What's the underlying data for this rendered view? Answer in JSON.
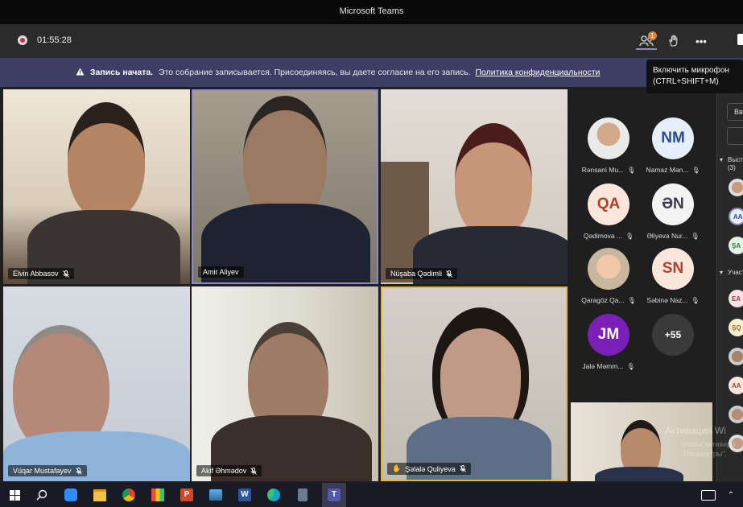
{
  "window": {
    "title": "Microsoft Teams"
  },
  "toolbar": {
    "recording_timer": "01:55:28",
    "participants_badge": "1",
    "more_label": "•••"
  },
  "banner": {
    "bold": "Запись начата.",
    "text": "Это собрание записывается. Присоединяясь, вы даете согласие на его запись.",
    "link": "Политика конфиденциальности"
  },
  "tooltip": {
    "line1": "Включить микрофон",
    "line2": "(CTRL+SHIFT+M)"
  },
  "video_tiles": [
    {
      "name": "Elvin Abbasov"
    },
    {
      "name": "Amir Aliyev"
    },
    {
      "name": "Nüşaba Qədimli"
    },
    {
      "name": "Vüqar Mustafayev"
    },
    {
      "name": "Akif Əhmədov"
    },
    {
      "name": "Şəlalə Quliyeva",
      "raised_hand": "✋"
    }
  ],
  "roster": [
    {
      "initials": "",
      "name": "Rənsani Mu...",
      "photo": true
    },
    {
      "initials": "NM",
      "name": "Namaz Man..."
    },
    {
      "initials": "QA",
      "name": "Qədimova ..."
    },
    {
      "initials": "ƏN",
      "name": "Əliyeva Nur..."
    },
    {
      "initials": "",
      "name": "Qaragöz Qa...",
      "photo": true
    },
    {
      "initials": "SN",
      "name": "Səbinə Naz..."
    },
    {
      "initials": "JM",
      "name": "Jalə Məmm..."
    },
    {
      "initials": "+55",
      "name": ""
    }
  ],
  "side_panel": {
    "search_stub": "Вв",
    "section1": "Выст",
    "section1_count": "(3)",
    "section2": "Участ",
    "avatars1": [
      "AA",
      "ŞA"
    ],
    "avatars2": [
      "EA",
      "ŞQ",
      "AA"
    ]
  },
  "watermark": {
    "line1": "Активация Wi",
    "line2": "Чтобы активиро",
    "line3": "\"Параметры\"."
  },
  "colors": {
    "banner": "#3d3e66",
    "active_speaker_border": "#8b8cc7",
    "raised_hand_border": "#e6b53c",
    "recording": "#c4314b"
  }
}
